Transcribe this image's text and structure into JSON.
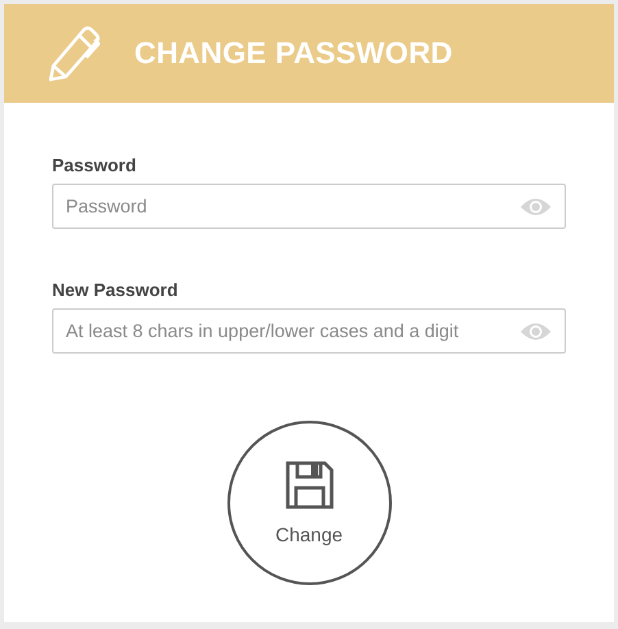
{
  "header": {
    "title": "CHANGE PASSWORD"
  },
  "fields": [
    {
      "label": "Password",
      "placeholder": "Password"
    },
    {
      "label": "New Password",
      "placeholder": "At least 8 chars in upper/lower cases and a digit"
    }
  ],
  "button": {
    "label": "Change"
  }
}
